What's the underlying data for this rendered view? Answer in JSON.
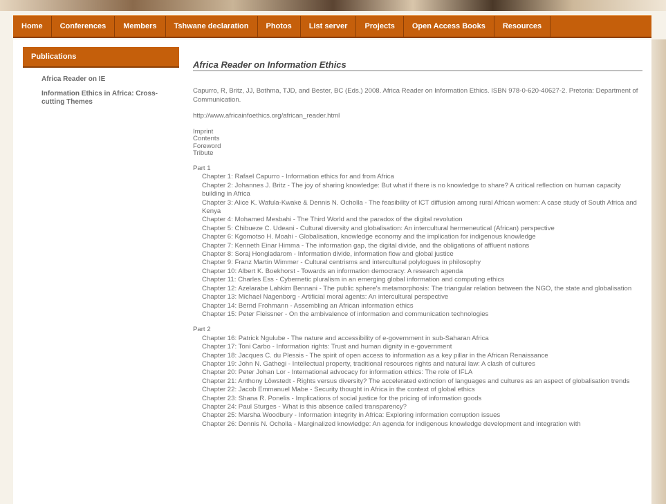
{
  "nav": {
    "items": [
      "Home",
      "Conferences",
      "Members",
      "Tshwane declaration",
      "Photos",
      "List server",
      "Projects",
      "Open Access Books",
      "Resources"
    ]
  },
  "sidebar": {
    "header": "Publications",
    "items": [
      "Africa Reader on IE",
      "Information Ethics in Africa: Cross-cutting Themes"
    ]
  },
  "content": {
    "title": "Africa Reader on Information Ethics",
    "citation": "Capurro, R, Britz, JJ, Bothma, TJD, and Bester, BC (Eds.) 2008. Africa Reader on Information Ethics. ISBN 978-0-620-40627-2. Pretoria: Department of Communication.",
    "url": "http://www.africainfoethics.org/african_reader.html",
    "links": [
      "Imprint",
      "Contents",
      "Foreword",
      "Tribute"
    ],
    "parts": [
      {
        "label": "Part 1",
        "chapters": [
          "Chapter 1: Rafael Capurro - Information ethics for and from Africa",
          "Chapter 2: Johannes J. Britz - The joy of sharing knowledge: But what if there is no knowledge to share? A critical reflection on human capacity building in Africa",
          "Chapter 3: Alice K. Wafula-Kwake & Dennis N. Ocholla - The feasibility of ICT diffusion among rural African women: A case study of South Africa and Kenya",
          "Chapter 4: Mohamed Mesbahi - The Third World and the paradox of the digital revolution",
          "Chapter 5: Chibueze C. Udeani - Cultural diversity and globalisation: An intercultural hermeneutical (African) perspective",
          "Chapter 6: Kgomotso H. Moahi - Globalisation, knowledge economy and the implication for indigenous knowledge",
          "Chapter 7: Kenneth Einar Himma - The information gap, the digital divide, and the obligations of affluent nations",
          "Chapter 8: Soraj Hongladarom - Information divide, information flow and global justice",
          "Chapter 9: Franz Martin Wimmer - Cultural centrisms and intercultural polylogues in philosophy",
          "Chapter 10: Albert K. Boekhorst - Towards an information democracy: A research agenda",
          "Chapter 11: Charles Ess - Cybernetic pluralism in an emerging global information and computing ethics",
          "Chapter 12: Azelarabe Lahkim Bennani - The public sphere's metamorphosis: The triangular relation between the NGO, the state and globalisation",
          "Chapter 13: Michael Nagenborg - Artificial moral agents: An intercultural perspective",
          "Chapter 14: Bernd Frohmann - Assembling an African information ethics",
          "Chapter 15: Peter Fleissner - On the ambivalence of information and communication technologies"
        ]
      },
      {
        "label": "Part 2",
        "chapters": [
          "Chapter 16: Patrick Ngulube - The nature and accessibility of e-government in sub-Saharan Africa",
          "Chapter 17: Toni Carbo - Information rights: Trust and human dignity in e-government",
          "Chapter 18: Jacques C. du Plessis - The spirit of open access to information as a key pillar in the African Renaissance",
          "Chapter 19: John N. Gathegi - Intellectual property, traditional resources rights and natural law: A clash of cultures",
          "Chapter 20: Peter Johan Lor - International advocacy for information ethics: The role of IFLA",
          "Chapter 21: Anthony Löwstedt - Rights versus diversity? The accelerated extinction of languages and cultures as an aspect of globalisation trends",
          "Chapter 22: Jacob Emmanuel Mabe - Security thought in Africa in the context of global ethics",
          "Chapter 23: Shana R. Ponelis - Implications of social justice for the pricing of information goods",
          "Chapter 24: Paul Sturges - What is this absence called transparency?",
          "Chapter 25: Marsha Woodbury - Information integrity in Africa: Exploring information corruption issues",
          "Chapter 26: Dennis N. Ocholla - Marginalized knowledge: An agenda for indigenous knowledge development and integration with"
        ]
      }
    ]
  }
}
